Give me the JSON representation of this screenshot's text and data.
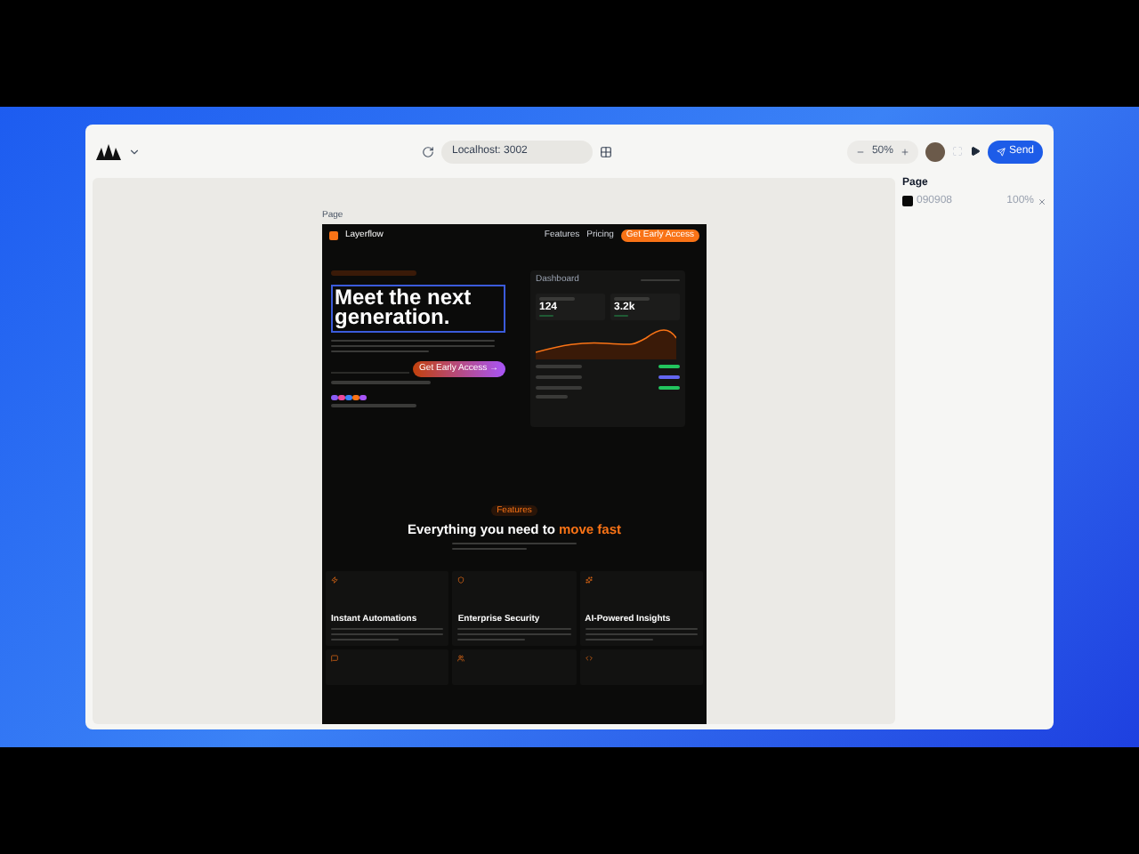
{
  "toolbar": {
    "url": "Localhost: 3002",
    "zoom": "50%",
    "send": "Send"
  },
  "inspector": {
    "title": "Page",
    "fill_hex": "090908",
    "opacity": "100%"
  },
  "canvas": {
    "frame_label": "Page"
  },
  "site": {
    "brand": "Layerflow",
    "nav": [
      "Features",
      "Pricing"
    ],
    "nav_cta": "Get Early Access",
    "headline": "Meet the next generation.",
    "cta": "Get Early Access →",
    "avatars": [
      {
        "color": "#8b5cf6"
      },
      {
        "color": "#ec4899"
      },
      {
        "color": "#3b82f6"
      },
      {
        "color": "#f97316"
      },
      {
        "color": "#a855f7"
      }
    ],
    "dashboard": {
      "title": "Dashboard",
      "stats": [
        {
          "value": "124"
        },
        {
          "value": "3.2k"
        }
      ],
      "rows": [
        {
          "color": "#22c55e"
        },
        {
          "color": "#6366f1"
        },
        {
          "color": "#22c55e"
        }
      ]
    },
    "features_badge": "Features",
    "features_title": "Everything you need to ",
    "features_title_accent": "move fast",
    "features": [
      {
        "title": "Instant Automations"
      },
      {
        "title": "Enterprise Security"
      },
      {
        "title": "AI-Powered Insights"
      }
    ]
  }
}
